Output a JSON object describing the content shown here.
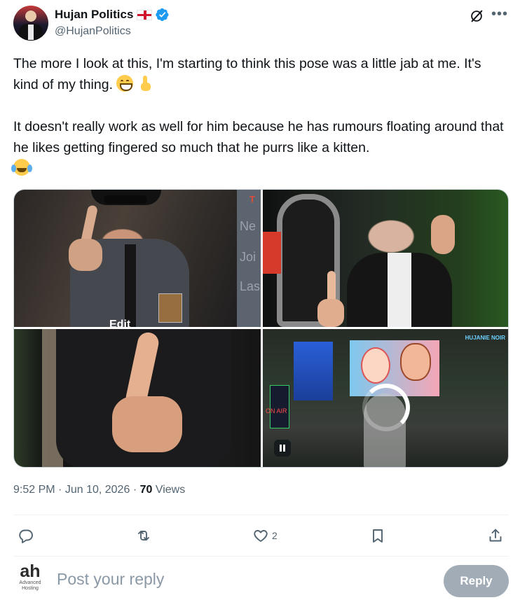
{
  "author": {
    "display_name": "Hujan Politics",
    "handle": "@HujanPolitics"
  },
  "icons": {
    "flag": "england-flag-icon",
    "verified": "verified-badge-icon",
    "grok": "grok-icon",
    "more": "more-icon",
    "reply": "reply-icon",
    "repost": "repost-icon",
    "like": "like-icon",
    "bookmark": "bookmark-icon",
    "share": "share-icon"
  },
  "tweet": {
    "paragraph1": "The more I look at this, I'm starting to think this pose was a little jab at me. It's kind of my thing.",
    "paragraph2": "It doesn't really work as well for him because he has rumours floating around that he likes getting fingered so much that he purrs like a kitten.",
    "media_overlay": {
      "tile1_panel_t": "T",
      "tile1_panel_lines": [
        "Ne",
        "Joi",
        "Las"
      ],
      "tile1_edit": "Edit",
      "tile4_onair": "ON AIR",
      "tile4_brand": "HUJANIE NOIR"
    }
  },
  "meta": {
    "time": "9:52 PM",
    "separator": "·",
    "date": "Jun 10, 2026",
    "views_count": "70",
    "views_label": "Views"
  },
  "actions": {
    "like_count": "2"
  },
  "reply": {
    "avatar_text": "ah",
    "avatar_sub1": "Advanced",
    "avatar_sub2": "Hosting",
    "placeholder": "Post your reply",
    "button_label": "Reply"
  },
  "colors": {
    "text": "#0f1419",
    "secondary": "#536471",
    "verified": "#1d9bf0",
    "border": "#cfd9de",
    "reply_button": "#8b98a5"
  }
}
